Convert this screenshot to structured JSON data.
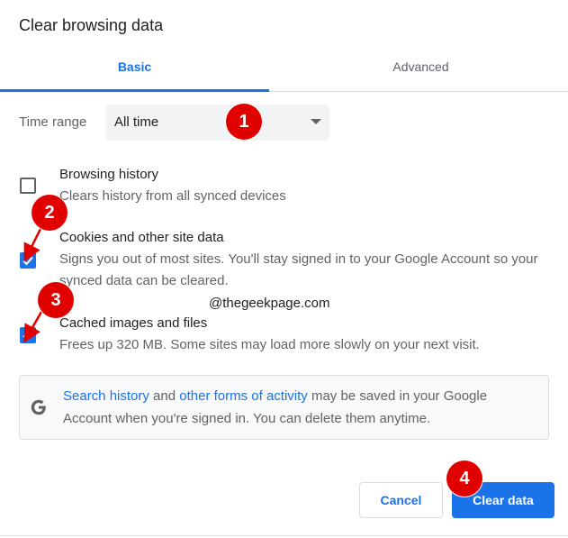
{
  "dialog": {
    "title": "Clear browsing data"
  },
  "tabs": [
    {
      "label": "Basic",
      "active": true
    },
    {
      "label": "Advanced",
      "active": false
    }
  ],
  "time_range": {
    "label": "Time range",
    "value": "All time"
  },
  "items": [
    {
      "title": "Browsing history",
      "description": "Clears history from all synced devices",
      "checked": false
    },
    {
      "title": "Cookies and other site data",
      "description": "Signs you out of most sites. You'll stay signed in to your Google Account so your synced data can be cleared.",
      "checked": true
    },
    {
      "title": "Cached images and files",
      "description": "Frees up 320 MB. Some sites may load more slowly on your next visit.",
      "checked": true
    }
  ],
  "watermark": "@thegeekpage.com",
  "info": {
    "link1": "Search history",
    "text1": " and ",
    "link2": "other forms of activity",
    "text2": " may be saved in your Google Account when you're signed in. You can delete them anytime."
  },
  "buttons": {
    "cancel": "Cancel",
    "clear": "Clear data"
  },
  "annotations": [
    "1",
    "2",
    "3",
    "4"
  ],
  "colors": {
    "accent": "#1a73e8",
    "annotation": "#e00000"
  }
}
